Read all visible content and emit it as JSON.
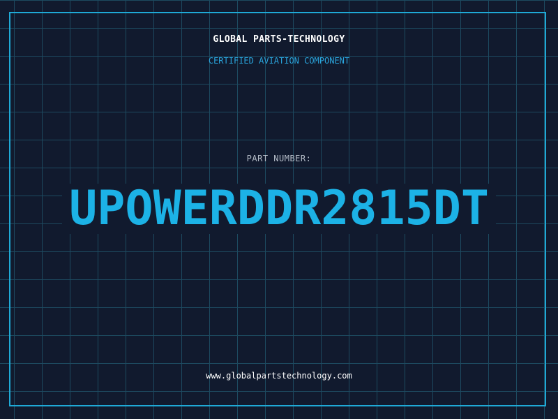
{
  "header": {
    "company": "GLOBAL PARTS-TECHNOLOGY",
    "subtitle": "CERTIFIED AVIATION COMPONENT"
  },
  "part": {
    "label": "PART NUMBER:",
    "number": "UPOWERDDR2815DT"
  },
  "footer": {
    "website": "www.globalpartstechnology.com"
  },
  "colors": {
    "background": "#111a2e",
    "grid": "#1d4a60",
    "accent": "#1fa9d6",
    "part_number": "#1cb2e6",
    "white": "#ffffff"
  }
}
